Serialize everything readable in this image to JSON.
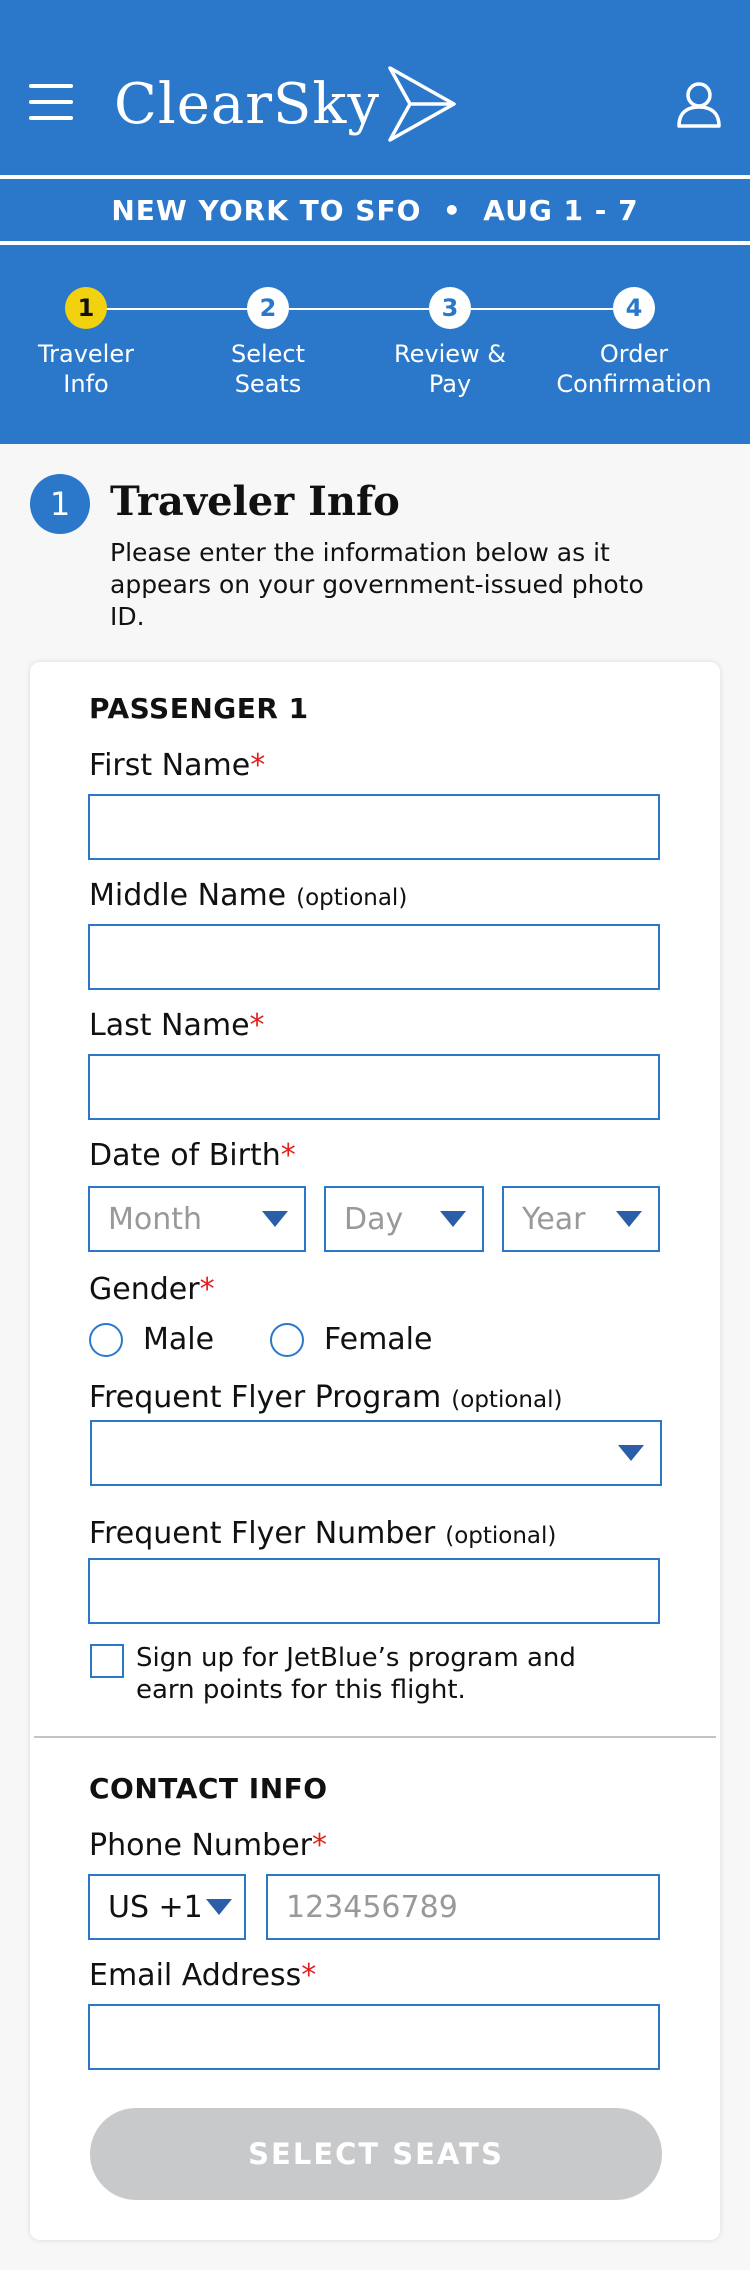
{
  "app": {
    "logo_text": "ClearSky"
  },
  "trip": {
    "summary": "NEW YORK TO SFO  •  AUG 1 - 7"
  },
  "steps": [
    {
      "number": "1",
      "label": "Traveler\nInfo",
      "active": true
    },
    {
      "number": "2",
      "label": "Select\nSeats",
      "active": false
    },
    {
      "number": "3",
      "label": "Review &\nPay",
      "active": false
    },
    {
      "number": "4",
      "label": "Order\nConfirmation",
      "active": false
    }
  ],
  "section": {
    "number": "1",
    "title": "Traveler Info",
    "description": "Please enter the information below as it appears on your government-issued photo ID."
  },
  "passenger": {
    "heading": "PASSENGER 1",
    "first_name_label": "First Name",
    "middle_name_label": "Middle Name",
    "optional_text": "(optional)",
    "last_name_label": "Last Name",
    "dob_label": "Date of Birth",
    "dob_month_placeholder": "Month",
    "dob_day_placeholder": "Day",
    "dob_year_placeholder": "Year",
    "gender_label": "Gender",
    "gender_options": [
      "Male",
      "Female"
    ],
    "ff_program_label": "Frequent Flyer Program",
    "ff_number_label": "Frequent Flyer Number",
    "signup_text": "Sign up for JetBlue’s program and earn points for this flight."
  },
  "required_mark": "*",
  "contact": {
    "heading": "CONTACT INFO",
    "phone_label": "Phone Number",
    "country_code": "US +1",
    "phone_placeholder": "123456789",
    "email_label": "Email Address"
  },
  "cta": {
    "label": "SELECT SEATS"
  },
  "colors": {
    "brand_blue": "#2b78cb",
    "active_step": "#f2d20e",
    "required": "#e02020",
    "disabled_button": "#c8c9cb"
  }
}
